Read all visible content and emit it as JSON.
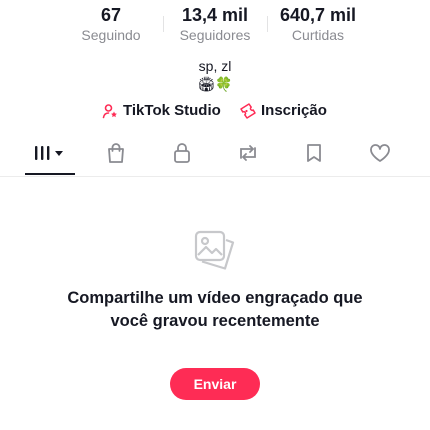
{
  "stats": {
    "following": {
      "value": "67",
      "label": "Seguindo"
    },
    "followers": {
      "value": "13,4 mil",
      "label": "Seguidores"
    },
    "likes": {
      "value": "640,7 mil",
      "label": "Curtidas"
    }
  },
  "bio": {
    "text": "sp, zl",
    "emojis": "🏟🍀"
  },
  "actions": {
    "studio_label": "TikTok Studio",
    "signup_label": "Inscrição"
  },
  "tabs": {
    "active": "videos",
    "icons": [
      "videos-grid-icon",
      "shopping-bag-icon",
      "lock-icon",
      "repost-icon",
      "bookmark-icon",
      "heart-icon"
    ]
  },
  "empty_state": {
    "title": "Compartilhe um vídeo engraçado que você gravou recentemente",
    "button_label": "Enviar"
  },
  "colors": {
    "accent": "#fe2c55",
    "text": "#161823",
    "muted": "#8a8b91"
  }
}
